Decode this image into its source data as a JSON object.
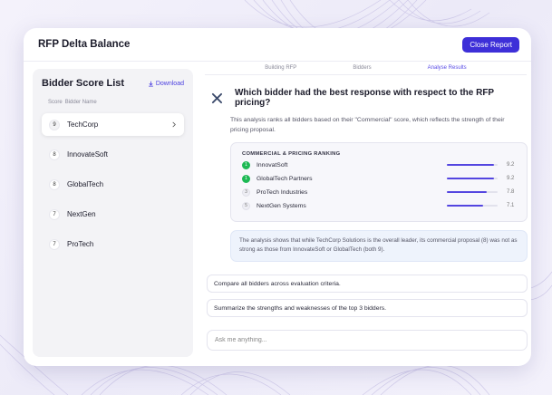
{
  "app": {
    "title": "RFP Delta Balance",
    "close_label": "Close Report"
  },
  "sidebar": {
    "title": "Bidder Score List",
    "download_label": "Download",
    "col_score": "Score",
    "col_name": "Bidder Name",
    "bidders": [
      {
        "score": "9",
        "name": "TechCorp",
        "active": true
      },
      {
        "score": "8",
        "name": "InnovateSoft"
      },
      {
        "score": "8",
        "name": "GlobalTech"
      },
      {
        "score": "7",
        "name": "NextGen"
      },
      {
        "score": "7",
        "name": "ProTech"
      }
    ]
  },
  "steps": [
    "Building RFP",
    "Bidders",
    "Analyse Results"
  ],
  "active_step": 2,
  "question": "Which bidder had the best response with respect to the RFP pricing?",
  "description": "This analysis ranks all bidders based on their \"Commercial\" score, which reflects the strength of their pricing proposal.",
  "ranking": {
    "title": "COMMERCIAL & PRICING RANKING",
    "max": 10,
    "rows": [
      {
        "rank": "1",
        "name": "InnovatSoft",
        "value": 9.2,
        "label": "9.2",
        "top": true
      },
      {
        "rank": "1",
        "name": "GlobalTech Partners",
        "value": 9.2,
        "label": "9.2",
        "top": true
      },
      {
        "rank": "3",
        "name": "ProTech Industries",
        "value": 7.8,
        "label": "7.8"
      },
      {
        "rank": "5",
        "name": "NextGen Systems",
        "value": 7.1,
        "label": "7.1"
      }
    ]
  },
  "note": "The analysis shows that while TechCorp Solutions is the overall leader, its commercial proposal (8) was not as strong as those from InnovateSoft or GlobalTech (both 9).",
  "suggestions": [
    "Compare all bidders across evaluation criteria.",
    "Summarize the strengths and weaknesses of the top 3 bidders."
  ],
  "chat": {
    "placeholder": "Ask me anything..."
  },
  "colors": {
    "accent": "#3d2fd8",
    "bar": "#5446e0",
    "top_badge": "#1db954"
  },
  "icons": {
    "download": "download-icon",
    "chevron": "chevron-right-icon",
    "question": "analysis-icon"
  }
}
